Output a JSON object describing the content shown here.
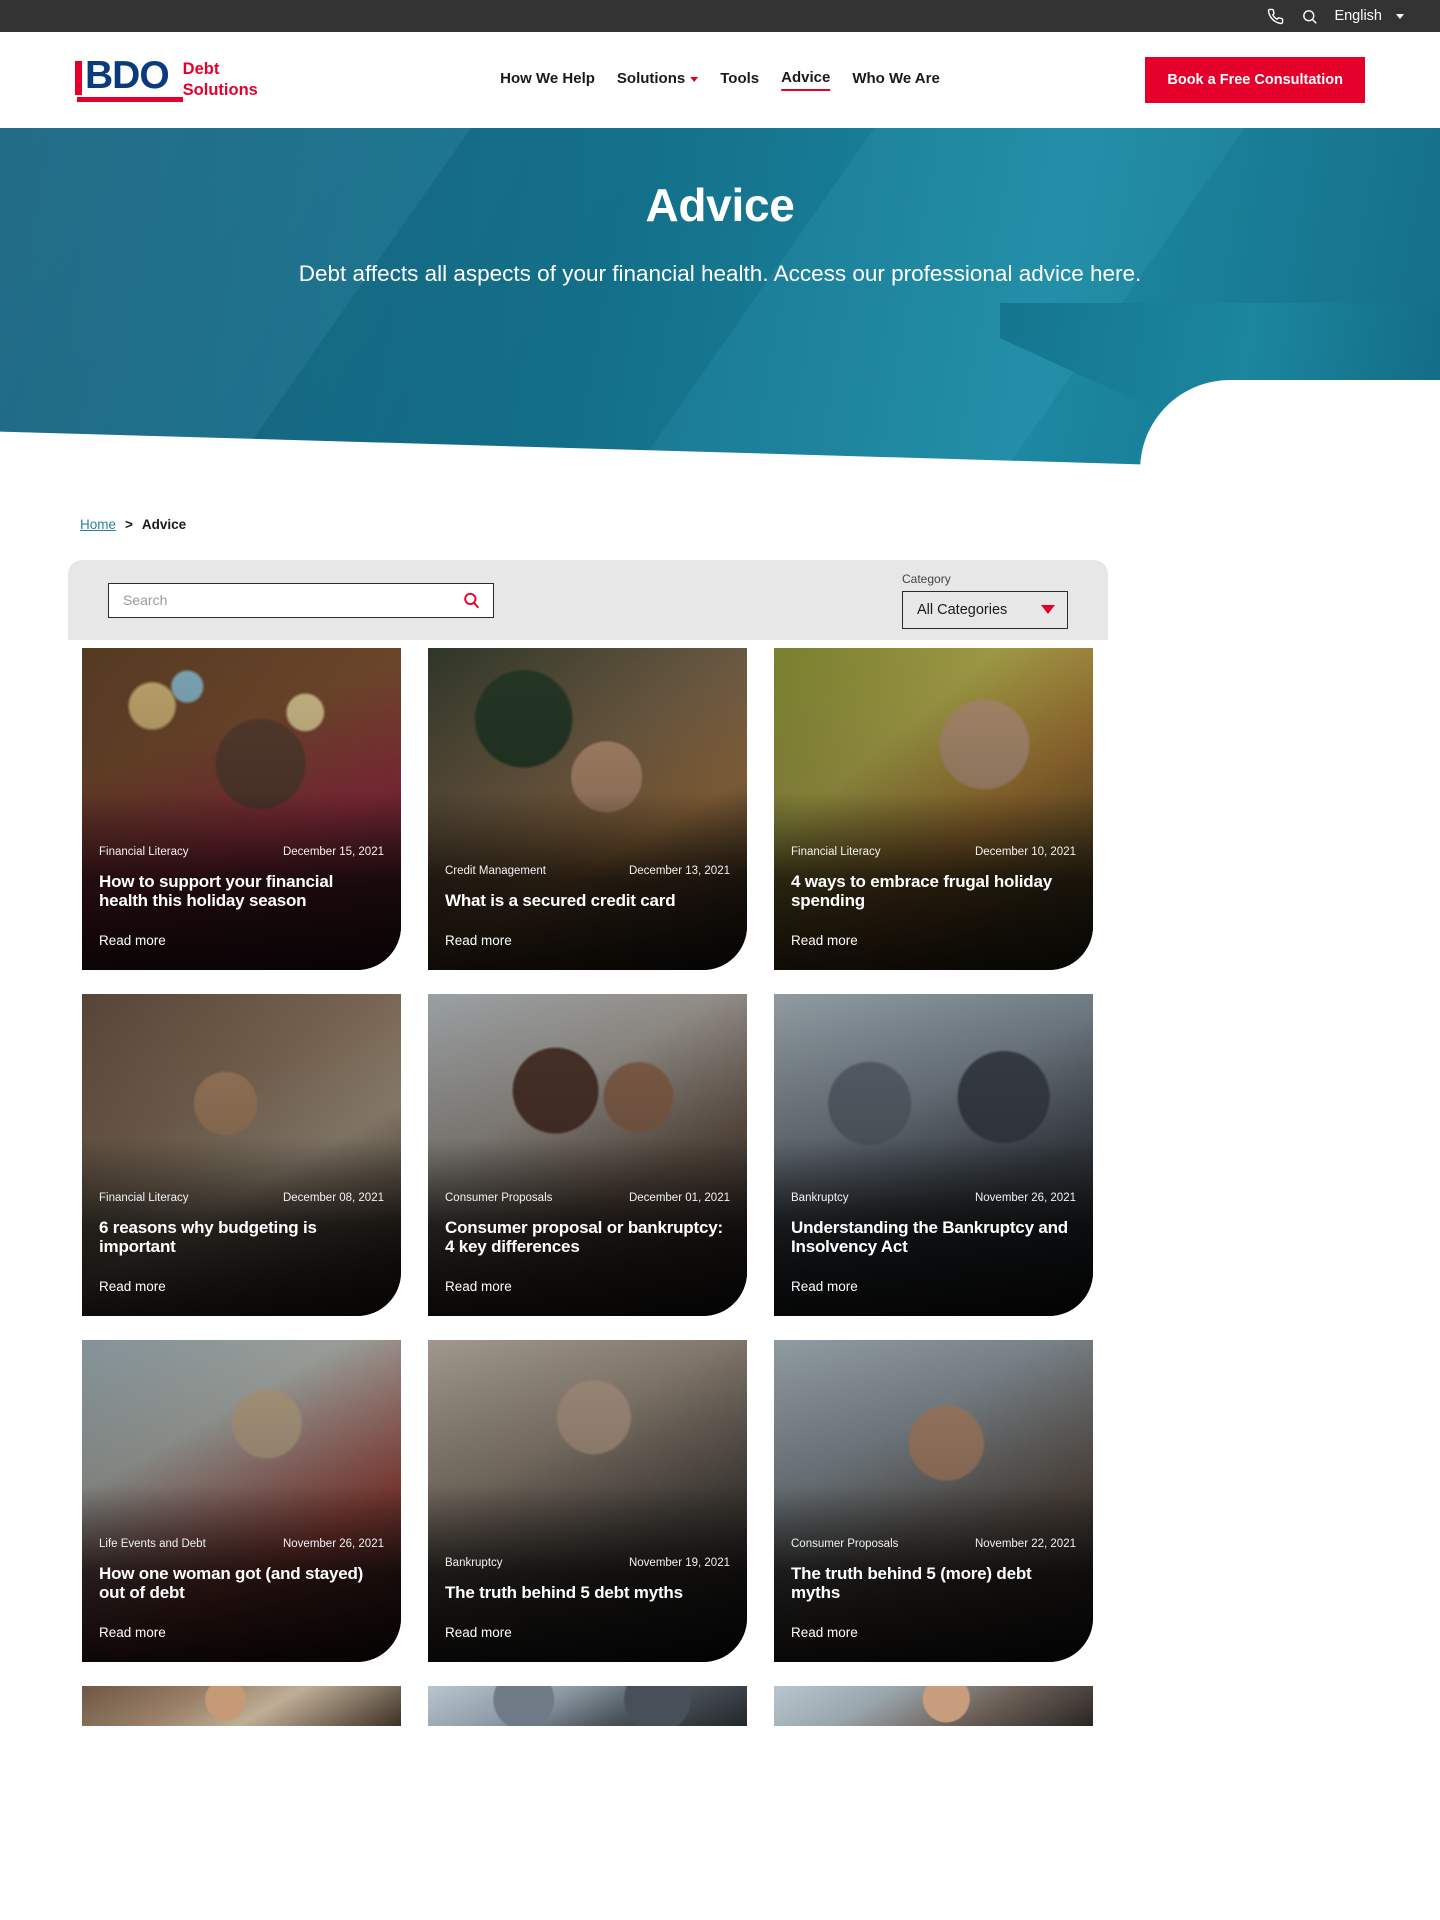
{
  "utility": {
    "phone_icon": "phone-icon",
    "search_icon": "search-icon",
    "language": "English"
  },
  "brand": {
    "logo_text": "BDO",
    "logo_sub_line1": "Debt",
    "logo_sub_line2": "Solutions",
    "primary_red": "#e4002b",
    "navy": "#0a3b7c"
  },
  "nav": {
    "items": [
      {
        "label": "How We Help",
        "active": false,
        "has_caret": false
      },
      {
        "label": "Solutions",
        "active": false,
        "has_caret": true
      },
      {
        "label": "Tools",
        "active": false,
        "has_caret": false
      },
      {
        "label": "Advice",
        "active": true,
        "has_caret": false
      },
      {
        "label": "Who We Are",
        "active": false,
        "has_caret": false
      }
    ],
    "cta": "Book a Free Consultation"
  },
  "hero": {
    "title": "Advice",
    "subtitle": "Debt affects all aspects of your financial health. Access our professional advice here.",
    "gradient_from": "#0f5f7d",
    "gradient_to": "#1d8ca6"
  },
  "breadcrumb": {
    "home": "Home",
    "separator": ">",
    "current": "Advice"
  },
  "filters": {
    "search_placeholder": "Search",
    "search_value": "",
    "category_label": "Category",
    "category_selected": "All Categories"
  },
  "cards": [
    {
      "category": "Financial Literacy",
      "date": "December 15, 2021",
      "title": "How to support your financial health this holiday season",
      "readmore": "Read more",
      "photo": "ph1"
    },
    {
      "category": "Credit Management",
      "date": "December 13, 2021",
      "title": "What is a secured credit card",
      "readmore": "Read more",
      "photo": "ph2"
    },
    {
      "category": "Financial Literacy",
      "date": "December 10, 2021",
      "title": "4 ways to embrace frugal holiday spending",
      "readmore": "Read more",
      "photo": "ph3"
    },
    {
      "category": "Financial Literacy",
      "date": "December 08, 2021",
      "title": "6 reasons why budgeting is important",
      "readmore": "Read more",
      "photo": "ph4"
    },
    {
      "category": "Consumer Proposals",
      "date": "December 01, 2021",
      "title": "Consumer proposal or bankruptcy: 4 key differences",
      "readmore": "Read more",
      "photo": "ph5"
    },
    {
      "category": "Bankruptcy",
      "date": "November 26, 2021",
      "title": "Understanding the Bankruptcy and Insolvency Act",
      "readmore": "Read more",
      "photo": "ph6"
    },
    {
      "category": "Life Events and Debt",
      "date": "November 26, 2021",
      "title": "How one woman got (and stayed) out of debt",
      "readmore": "Read more",
      "photo": "ph7"
    },
    {
      "category": "Bankruptcy",
      "date": "November 19, 2021",
      "title": "The truth behind 5 debt myths",
      "readmore": "Read more",
      "photo": "ph8"
    },
    {
      "category": "Consumer Proposals",
      "date": "November 22, 2021",
      "title": "The truth behind 5 (more) debt myths",
      "readmore": "Read more",
      "photo": "ph9"
    }
  ]
}
